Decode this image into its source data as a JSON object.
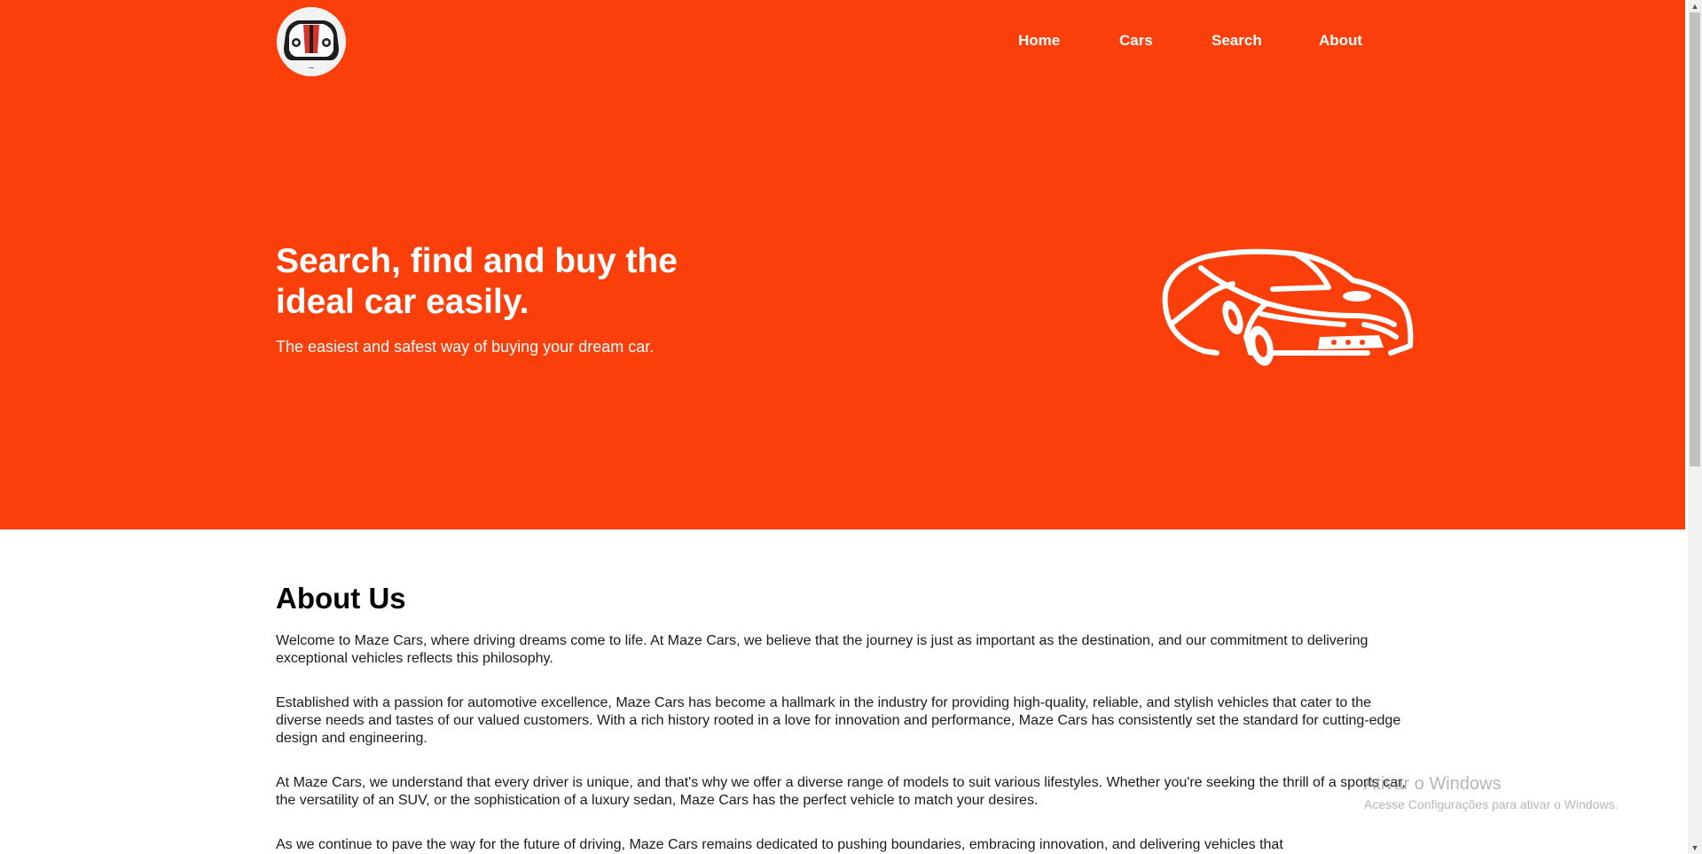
{
  "nav": {
    "home": "Home",
    "cars": "Cars",
    "search": "Search",
    "about": "About"
  },
  "logo": {
    "icon": "car-logo-icon"
  },
  "hero": {
    "title": "Search, find and buy the ideal car easily.",
    "subtitle": "The easiest and safest way of buying your dream car.",
    "illustration": "car-outline-icon"
  },
  "about": {
    "title": "About Us",
    "paragraphs": [
      "Welcome to Maze Cars, where driving dreams come to life. At Maze Cars, we believe that the journey is just as important as the destination, and our commitment to delivering exceptional vehicles reflects this philosophy.",
      "Established with a passion for automotive excellence, Maze Cars has become a hallmark in the industry for providing high-quality, reliable, and stylish vehicles that cater to the diverse needs and tastes of our valued customers. With a rich history rooted in a love for innovation and performance, Maze Cars has consistently set the standard for cutting-edge design and engineering.",
      "At Maze Cars, we understand that every driver is unique, and that's why we offer a diverse range of models to suit various lifestyles. Whether you're seeking the thrill of a sports car, the versatility of an SUV, or the sophistication of a luxury sedan, Maze Cars has the perfect vehicle to match your desires.",
      "As we continue to pave the way for the future of driving, Maze Cars remains dedicated to pushing boundaries, embracing innovation, and delivering vehicles that"
    ]
  },
  "watermark": {
    "title": "Ativar o Windows",
    "subtitle": "Acesse Configurações para ativar o Windows."
  },
  "colors": {
    "brand": "#fa3f0a",
    "text_light": "#ffffff",
    "text_dark": "#000000"
  }
}
